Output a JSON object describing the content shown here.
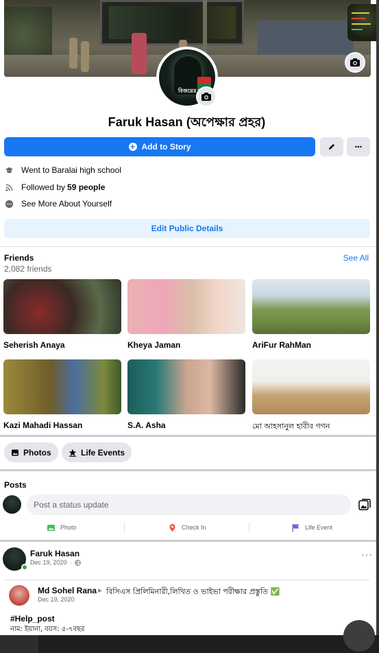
{
  "profile": {
    "name": "Faruk Hasan (অপেক্ষার প্রহর)",
    "avatar_caption": "বিজয়ের মাসে",
    "actions": {
      "add_story": "Add to Story",
      "edit_icon": "pencil-icon",
      "more_icon": "ellipsis-icon"
    },
    "details": [
      {
        "icon": "graduation-cap-icon",
        "text": "Went to Baralai high school",
        "bold": ""
      },
      {
        "icon": "rss-icon",
        "text": "Followed by",
        "bold": "59 people"
      },
      {
        "icon": "dots-circle-icon",
        "text": "See More About Yourself",
        "bold": ""
      }
    ],
    "edit_public_details": "Edit Public Details"
  },
  "friends": {
    "title": "Friends",
    "count": "2,082 friends",
    "see_all": "See All",
    "items": [
      {
        "name": "Seherish Anaya"
      },
      {
        "name": "Kheya Jaman"
      },
      {
        "name": "AriFur RahMan"
      },
      {
        "name": "Kazi Mahadi Hassan"
      },
      {
        "name": "S.A. Asha"
      },
      {
        "name": "মো আহসানুল হাবীব গগন"
      }
    ]
  },
  "chips": [
    {
      "label": "Photos",
      "icon": "photo-icon"
    },
    {
      "label": "Life Events",
      "icon": "star-icon"
    }
  ],
  "posts": {
    "title": "Posts",
    "status_placeholder": "Post a status update",
    "actions": [
      {
        "label": "Photo",
        "icon": "photo-icon",
        "color": "#45bd62"
      },
      {
        "label": "Check In",
        "icon": "location-pin-icon",
        "color": "#f5533d"
      },
      {
        "label": "Life Event",
        "icon": "flag-icon",
        "color": "#7b5cd6"
      }
    ]
  },
  "post": {
    "author": "Faruk Hasan",
    "date": "Dec 19, 2020",
    "shared_author": "Md Sohel Rana",
    "shared_to": "বিসিএস প্রিলিমিনারী,লিখিত ও ভাইভা পরীক্ষার প্রস্তুতি ✅",
    "shared_date": "Dec 19, 2020",
    "hashtag": "#Help_post",
    "body": "নাম: ইয়ানা, বয়স: ৫-৭বছর"
  },
  "colors": {
    "primary": "#1877f2",
    "light_primary": "#e7f3ff",
    "secondary_button": "#e4e6eb",
    "online": "#31a24c"
  }
}
